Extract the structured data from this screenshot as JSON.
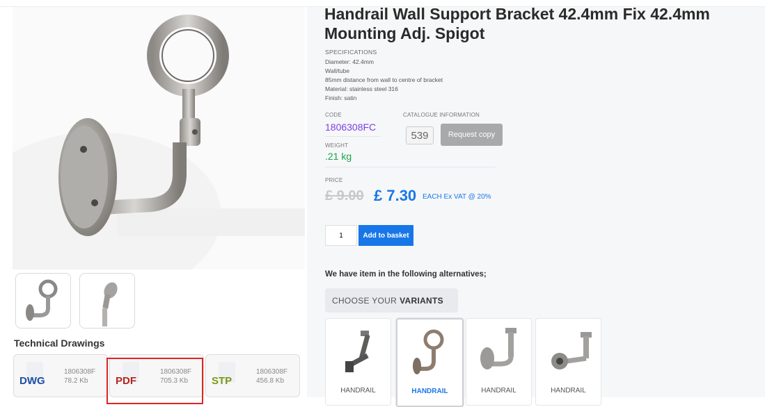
{
  "product": {
    "title": "Handrail Wall Support Bracket 42.4mm Fix 42.4mm Mounting Adj. Spigot",
    "specs_heading": "SPECIFICATIONS",
    "specs": [
      "Diameter: 42.4mm",
      "Wall/tube",
      "85mm distance from wall to centre of bracket",
      "Material: stainless steel 316",
      "Finish: satin"
    ],
    "code_label": "CODE",
    "code": "1806308FC",
    "weight_label": "WEIGHT",
    "weight": ".21 kg",
    "catalogue_label": "CATALOGUE INFORMATION",
    "catalogue_page": "539",
    "request_copy_label": "Request copy",
    "price_label": "PRICE",
    "price_old": "£ 9.00",
    "price_new": "£ 7.30",
    "price_note": "EACH Ex VAT @ 20%"
  },
  "basket": {
    "quantity": "1",
    "add_label": "Add to basket"
  },
  "alternatives": {
    "heading": "We have item in the following alternatives;",
    "choose_prefix": "CHOOSE YOUR",
    "choose_bold": "VARIANTS",
    "variants": [
      {
        "label": "HANDRAIL"
      },
      {
        "label": "HANDRAIL"
      },
      {
        "label": "HANDRAIL"
      },
      {
        "label": "HANDRAIL"
      }
    ]
  },
  "technical": {
    "heading": "Technical Drawings",
    "files": [
      {
        "type": "DWG",
        "name": "1806308F",
        "size": "78.2 Kb",
        "color": "#1f4fa3"
      },
      {
        "type": "PDF",
        "name": "1806308F",
        "size": "705.3 Kb",
        "color": "#b3261e"
      },
      {
        "type": "STP",
        "name": "1806308F",
        "size": "456.8 Kb",
        "color": "#7a9a14"
      }
    ]
  },
  "colors": {
    "accent": "#1877e8",
    "code": "#7b3fe4",
    "weight": "#1aa34a",
    "highlight": "#e02424"
  }
}
